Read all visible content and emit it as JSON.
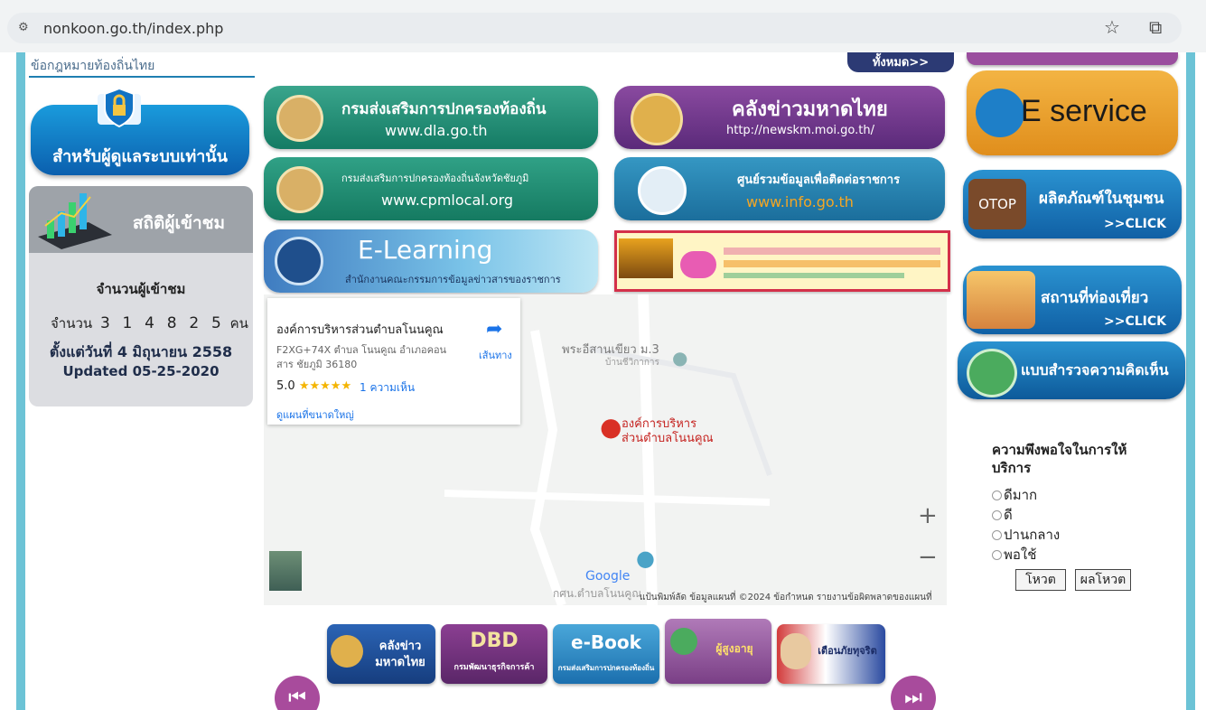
{
  "browser": {
    "url": "nonkoon.go.th/index.php"
  },
  "left": {
    "law_link": "ข้อกฎหมายท้องถิ่นไทย",
    "admin_label": "สำหรับผู้ดูแลระบบเท่านั้น",
    "stats_title": "สถิติผู้เข้าชม",
    "visitor_title": "จำนวนผู้เข้าชม",
    "visitor_prefix": "จำนวน",
    "digits": [
      "3",
      "1",
      "4",
      "8",
      "2",
      "5"
    ],
    "visitor_suffix": "คน",
    "since": "ตั้งแต่วันที่ 4 มิถุนายน 2558",
    "updated": "Updated 05-25-2020"
  },
  "center": {
    "see_all": "ทั้งหมด>>",
    "dla_title": "กรมส่งเสริมการปกครองท้องถิ่น",
    "dla_url": "www.dla.go.th",
    "cpm_title": "กรมส่งเสริมการปกครองท้องถิ่นจังหวัดชัยภูมิ",
    "cpm_url": "www.cpmlocal.org",
    "elearning_title": "E-Learning",
    "elearning_sub": "สำนักงานคณะกรรมการข้อมูลข่าวสารของราชการ",
    "newskm_title": "คลังข่าวมหาดไทย",
    "newskm_url": "http://newskm.moi.go.th/",
    "info_title": "ศูนย์รวมข้อมูลเพื่อติดต่อราชการ",
    "info_url": "www.info.go.th"
  },
  "map": {
    "place_name": "องค์การบริหารส่วนตำบลโนนคูณ",
    "address_line1": "F2XG+74X ตำบล โนนคูณ อำเภอคอน",
    "address_line2": "สาร ชัยภูมิ 36180",
    "rating": "5.0",
    "stars": "★★★★★",
    "reviews": "1 ความเห็น",
    "bigger_map": "ดูแผนที่ขนาดใหญ่",
    "directions": "เส้นทาง",
    "poi": "พระอีสานเขียว ม.3",
    "poi_sub": "บ้านชีวิกาการ",
    "pin_label_1": "องค์การบริหาร",
    "pin_label_2": "ส่วนตำบลโนนคูณ",
    "zoom_in": "+",
    "zoom_out": "−",
    "google": "Google",
    "road": "กศน.ตำบลโนนคูณ",
    "footer": "แป้นพิมพ์ลัด   ข้อมูลแผนที่ ©2024   ข้อกำหนด   รายงานข้อผิดพลาดของแผนที่"
  },
  "bottom": {
    "newskm": "คลังข่าว มหาดไทย",
    "dbd": "DBD",
    "dbd_sub": "กรมพัฒนาธุรกิจการค้า",
    "ebook": "e-Book",
    "ebook_sub": "กรมส่งเสริมการปกครองท้องถิ่น",
    "elderly": "ผู้สูงอายุ",
    "fraud": "เตือนภัยทุจริต"
  },
  "right": {
    "eservice": "E service",
    "otop": "OTOP",
    "otop_title": "ผลิตภัณฑ์ในชุมชน",
    "otop_click": ">>CLICK",
    "tour_title": "สถานที่ท่องเที่ยว",
    "tour_click": ">>CLICK",
    "survey_title": "แบบสำรวจความคิดเห็น",
    "vote_question": "ความพึงพอใจในการให้บริการ",
    "vote_options": [
      "ดีมาก",
      "ดี",
      "ปานกลาง",
      "พอใช้"
    ],
    "vote_button": "โหวต",
    "results_button": "ผลโหวต"
  }
}
